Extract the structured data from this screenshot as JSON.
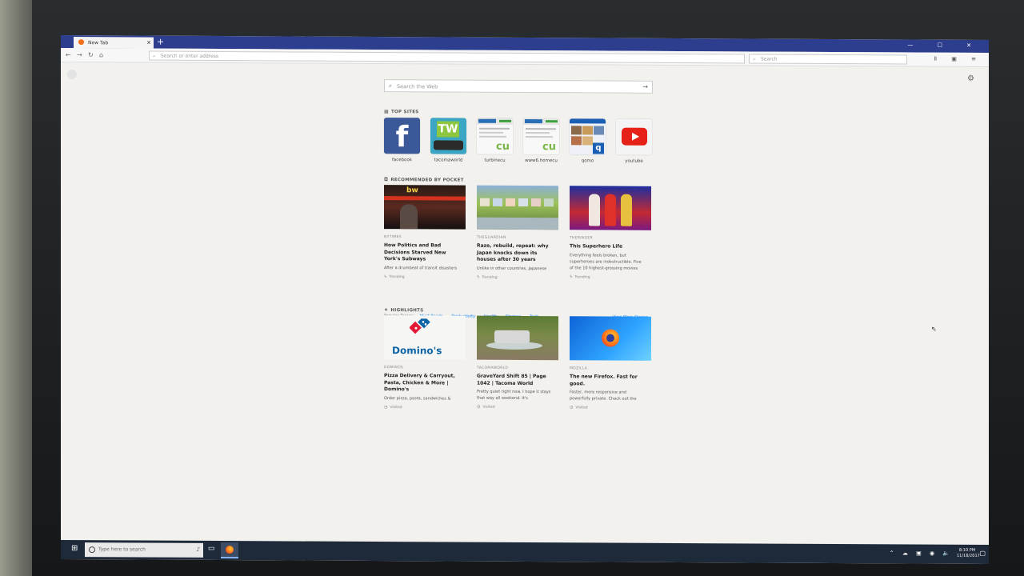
{
  "browser": {
    "tab_title": "New Tab",
    "new_tab_glyph": "+",
    "window_controls": "— ☐ ✕",
    "url_placeholder": "Search or enter address",
    "search_placeholder": "Search",
    "toolbar_icons": "Ⅱ ▣ ≡"
  },
  "newtab": {
    "web_search_placeholder": "Search the Web",
    "top_sites_heading": "TOP SITES",
    "top_sites": [
      {
        "label": "facebook",
        "glyph": "f"
      },
      {
        "label": "tacomaworld",
        "glyph": "TW"
      },
      {
        "label": "turbinecu",
        "glyph": "cu"
      },
      {
        "label": "www6.homecu",
        "glyph": "cu"
      },
      {
        "label": "qomo",
        "glyph": "q"
      },
      {
        "label": "youtube",
        "glyph": ""
      }
    ],
    "pocket_heading": "RECOMMENDED BY POCKET",
    "pocket_cards": [
      {
        "source": "NYTIMES",
        "title": "How Politics and Bad Decisions Starved New York's Subways",
        "desc": "After a drumbeat of transit disasters",
        "tag": "Trending",
        "image_text": "bw"
      },
      {
        "source": "THEGUARDIAN",
        "title": "Raze, rebuild, repeat: why Japan knocks down its houses after 30 years",
        "desc": "Unlike in other countries, Japanese",
        "tag": "Trending"
      },
      {
        "source": "THERINGER",
        "title": "This Superhero Life",
        "desc": "Everything feels broken, but superheroes are indestructible. Five of the 10 highest-grossing movies",
        "tag": "Trending"
      }
    ],
    "popular_topics_label": "Popular Topics:",
    "popular_topics": [
      "Must Reads",
      "Productivity",
      "Health",
      "Finance",
      "Tech"
    ],
    "view_more": "View More Stories",
    "highlights_heading": "HIGHLIGHTS",
    "highlight_cards": [
      {
        "source": "DOMINOS",
        "title": "Pizza Delivery & Carryout, Pasta, Chicken & More | Domino's",
        "desc": "Order pizza, pasta, sandwiches &",
        "tag": "Visited",
        "image_text": "Domino's"
      },
      {
        "source": "TACOMAWORLD",
        "title": "GraveYard Shift 85 | Page 1042 | Tacoma World",
        "desc": "Pretty quiet right now. I hope it stays that way all weekend. It's",
        "tag": "Visited"
      },
      {
        "source": "MOZILLA",
        "title": "The new Firefox. Fast for good.",
        "desc": "Faster, more responsive and powerfully private. Check out the",
        "tag": "Visited"
      }
    ]
  },
  "taskbar": {
    "search_placeholder": "Type here to search",
    "time": "8:10 PM",
    "date": "11/18/2017"
  }
}
